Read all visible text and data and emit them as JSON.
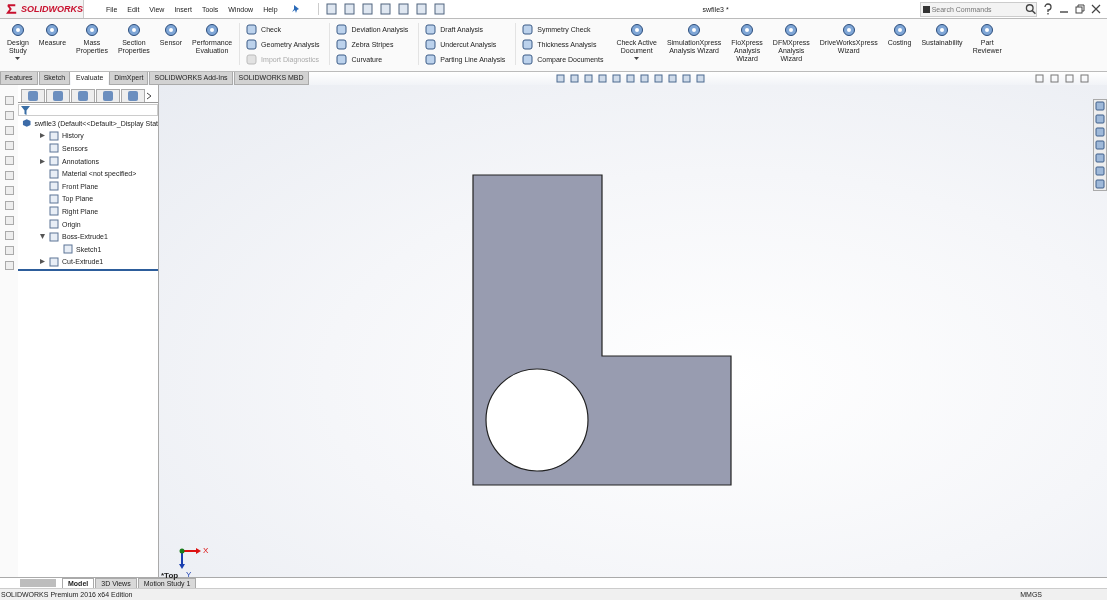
{
  "app": {
    "logo": "SOLIDWORKS",
    "title": "swfile3 *"
  },
  "menu": [
    "File",
    "Edit",
    "View",
    "Insert",
    "Tools",
    "Window",
    "Help"
  ],
  "search": {
    "placeholder": "Search Commands"
  },
  "ribbon": [
    {
      "kind": "large",
      "lines": [
        "Design",
        "Study"
      ],
      "dropdown": true
    },
    {
      "kind": "large",
      "lines": [
        "Measure"
      ],
      "dropdown": false
    },
    {
      "kind": "large",
      "lines": [
        "Mass",
        "Properties"
      ],
      "dropdown": false
    },
    {
      "kind": "large",
      "lines": [
        "Section",
        "Properties"
      ],
      "dropdown": false
    },
    {
      "kind": "large",
      "lines": [
        "Sensor"
      ],
      "dropdown": false
    },
    {
      "kind": "large",
      "lines": [
        "Performance",
        "Evaluation"
      ],
      "dropdown": false
    },
    {
      "kind": "column",
      "items": [
        {
          "label": "Check",
          "disabled": false
        },
        {
          "label": "Geometry Analysis",
          "disabled": false
        },
        {
          "label": "Import Diagnostics",
          "disabled": true
        }
      ]
    },
    {
      "kind": "column",
      "items": [
        {
          "label": "Deviation Analysis",
          "disabled": false
        },
        {
          "label": "Zebra Stripes",
          "disabled": false
        },
        {
          "label": "Curvature",
          "disabled": false
        }
      ]
    },
    {
      "kind": "column",
      "items": [
        {
          "label": "Draft Analysis",
          "disabled": false
        },
        {
          "label": "Undercut Analysis",
          "disabled": false
        },
        {
          "label": "Parting Line Analysis",
          "disabled": false
        }
      ]
    },
    {
      "kind": "column",
      "items": [
        {
          "label": "Symmetry Check",
          "disabled": false
        },
        {
          "label": "Thickness Analysis",
          "disabled": false
        },
        {
          "label": "Compare Documents",
          "disabled": false
        }
      ]
    },
    {
      "kind": "large",
      "lines": [
        "Check Active",
        "Document"
      ],
      "dropdown": true
    },
    {
      "kind": "large",
      "lines": [
        "SimulationXpress",
        "Analysis Wizard"
      ],
      "dropdown": false
    },
    {
      "kind": "large",
      "lines": [
        "FloXpress",
        "Analysis",
        "Wizard"
      ],
      "dropdown": false
    },
    {
      "kind": "large",
      "lines": [
        "DFMXpress",
        "Analysis",
        "Wizard"
      ],
      "dropdown": false
    },
    {
      "kind": "large",
      "lines": [
        "DriveWorksXpress",
        "Wizard"
      ],
      "dropdown": false
    },
    {
      "kind": "large",
      "lines": [
        "Costing"
      ],
      "dropdown": false
    },
    {
      "kind": "large",
      "lines": [
        "Sustainability"
      ],
      "dropdown": false
    },
    {
      "kind": "large",
      "lines": [
        "Part",
        "Reviewer"
      ],
      "dropdown": false
    }
  ],
  "command_tabs": [
    {
      "label": "Features",
      "selected": false
    },
    {
      "label": "Sketch",
      "selected": false
    },
    {
      "label": "Evaluate",
      "selected": true
    },
    {
      "label": "DimXpert",
      "selected": false
    },
    {
      "label": "SOLIDWORKS Add-Ins",
      "selected": false
    },
    {
      "label": "SOLIDWORKS MBD",
      "selected": false
    }
  ],
  "feature_tree": {
    "root": "swfile3  (Default<<Default>_Display Stat",
    "items": [
      {
        "label": "History",
        "expanded": false
      },
      {
        "label": "Sensors"
      },
      {
        "label": "Annotations",
        "expanded": false
      },
      {
        "label": "Material <not specified>"
      },
      {
        "label": "Front Plane"
      },
      {
        "label": "Top Plane"
      },
      {
        "label": "Right Plane"
      },
      {
        "label": "Origin"
      },
      {
        "label": "Boss-Extrude1",
        "expanded": true,
        "children": [
          {
            "label": "Sketch1"
          }
        ]
      },
      {
        "label": "Cut-Extrude1",
        "expanded": false
      }
    ]
  },
  "view": {
    "orientation": "*Top",
    "triad": [
      "X",
      "Y"
    ]
  },
  "bottom_tabs": [
    {
      "label": "Model",
      "selected": true
    },
    {
      "label": "3D Views",
      "selected": false
    },
    {
      "label": "Motion Study 1",
      "selected": false
    }
  ],
  "status_bar": {
    "edition": "SOLIDWORKS Premium 2016 x64 Edition",
    "units": "MMGS"
  }
}
